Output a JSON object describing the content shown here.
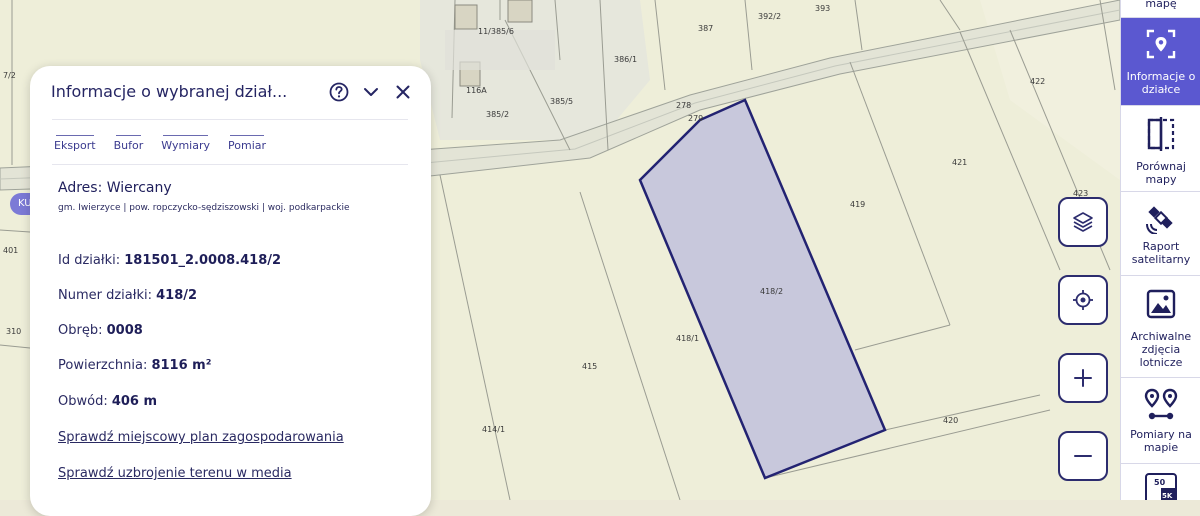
{
  "panel": {
    "title": "Informacje o wybranej dział...",
    "tabs": [
      "Eksport",
      "Bufor",
      "Wymiary",
      "Pomiar"
    ],
    "address_title": "Adres: Wiercany",
    "address_sub": "gm. Iwierzyce | pow. ropczycko-sędziszowski | woj. podkarpackie",
    "fields": [
      {
        "label": "Id działki:",
        "value": "181501_2.0008.418/2"
      },
      {
        "label": "Numer działki:",
        "value": "418/2"
      },
      {
        "label": "Obręb:",
        "value": "0008"
      },
      {
        "label": "Powierzchnia:",
        "value": "8116 m²"
      },
      {
        "label": "Obwód:",
        "value": "406 m"
      }
    ],
    "links": [
      "Sprawdź miejscowy plan zagospodarowania",
      "Sprawdź uzbrojenie terenu w media"
    ]
  },
  "badge_text": "KU",
  "map_labels": [
    {
      "id": "l392_2",
      "text": "392/2"
    },
    {
      "id": "l393",
      "text": "393"
    },
    {
      "id": "l387",
      "text": "387"
    },
    {
      "id": "l386_1",
      "text": "386/1"
    },
    {
      "id": "l385_6",
      "text": "11/385/6"
    },
    {
      "id": "l116a",
      "text": "116A"
    },
    {
      "id": "l385_5",
      "text": "385/5"
    },
    {
      "id": "l385_2",
      "text": "385/2"
    },
    {
      "id": "l278",
      "text": "278"
    },
    {
      "id": "l279",
      "text": "279"
    },
    {
      "id": "l422",
      "text": "422"
    },
    {
      "id": "l421",
      "text": "421"
    },
    {
      "id": "l423",
      "text": "423"
    },
    {
      "id": "l419",
      "text": "419"
    },
    {
      "id": "l418_2",
      "text": "418/2"
    },
    {
      "id": "l418_1",
      "text": "418/1"
    },
    {
      "id": "l415",
      "text": "415"
    },
    {
      "id": "l414_1",
      "text": "414/1"
    },
    {
      "id": "l420",
      "text": "420"
    },
    {
      "id": "l401",
      "text": "401"
    },
    {
      "id": "l310",
      "text": "310"
    },
    {
      "id": "l7_2",
      "text": "7/2"
    }
  ],
  "toolbar": {
    "items": [
      {
        "label1": "mapę",
        "label2": ""
      },
      {
        "label1": "Informacje o",
        "label2": "działce"
      },
      {
        "label1": "Porównaj",
        "label2": "mapy"
      },
      {
        "label1": "Raport",
        "label2": "satelitarny"
      },
      {
        "label1": "Archiwalne",
        "label2": "zdjęcia",
        "label3": "lotnicze"
      },
      {
        "label1": "Pomiary na",
        "label2": "mapie"
      }
    ],
    "scale_top": "50",
    "scale_bottom": "5K"
  },
  "colors": {
    "accent": "#5b58d0",
    "navy": "#1f1f5c",
    "parcel_fill": "#c8c8dc",
    "parcel_stroke": "#232372"
  }
}
